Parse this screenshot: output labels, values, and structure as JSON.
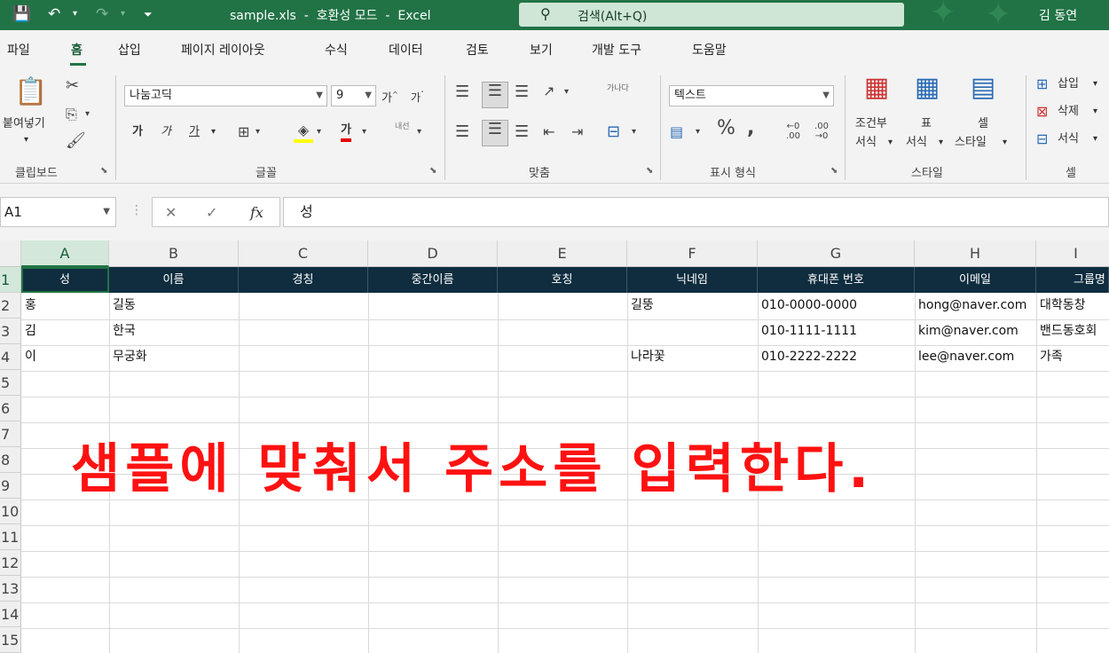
{
  "titlebar": {
    "title": "sample.xls  -  호환성 모드  -  Excel",
    "search_placeholder": "검색(Alt+Q)",
    "user": "김 동연"
  },
  "menu": [
    "파일",
    "홈",
    "삽입",
    "페이지 레이아웃",
    "수식",
    "데이터",
    "검토",
    "보기",
    "개발 도구",
    "도움말"
  ],
  "ribbon": {
    "clipboard": {
      "paste_label": "붙여넣기",
      "group": "클립보드"
    },
    "font": {
      "font_name": "나눔고딕",
      "font_size": "9",
      "group": "글꼴",
      "bold": "가",
      "italic": "가",
      "underline": "가",
      "font_color_glyph": "가",
      "phonetic": "내선"
    },
    "alignment": {
      "group": "맞춤",
      "wrap": "가나다"
    },
    "number": {
      "format": "텍스트",
      "group": "표시 형식"
    },
    "styles": {
      "group": "스타일",
      "conditional": "조건부\n서식",
      "cond1": "조건부",
      "cond2": "서식",
      "table1": "표",
      "table2": "서식",
      "cell1": "셀",
      "cell2": "스타일"
    },
    "cells": {
      "group": "셀",
      "insert": "삽입",
      "delete": "삭제",
      "format": "서식"
    }
  },
  "formula_bar": {
    "name_box": "A1",
    "content": "성"
  },
  "sheet": {
    "columns": [
      "A",
      "B",
      "C",
      "D",
      "E",
      "F",
      "G",
      "H",
      "I"
    ],
    "rows": [
      "1",
      "2",
      "3",
      "4",
      "5",
      "6",
      "7",
      "8",
      "9",
      "10",
      "11",
      "12",
      "13",
      "14",
      "15"
    ],
    "headers": [
      "성",
      "이름",
      "경칭",
      "중간이름",
      "호칭",
      "닉네임",
      "휴대폰 번호",
      "이메일",
      "그룹명"
    ],
    "data": [
      [
        "홍",
        "길동",
        "",
        "",
        "",
        "길뚱",
        "010-0000-0000",
        "hong@naver.com",
        "대학동창"
      ],
      [
        "김",
        "한국",
        "",
        "",
        "",
        "",
        "010-1111-1111",
        "kim@naver.com",
        "밴드동호회"
      ],
      [
        "이",
        "무궁화",
        "",
        "",
        "",
        "나라꽃",
        "010-2222-2222",
        "lee@naver.com",
        "가족"
      ]
    ]
  },
  "overlay_text": "샘플에 맞춰서 주소를 입력한다.",
  "colors": {
    "excel_green": "#217346",
    "header_fill": "#0f2d3f",
    "overlay_red": "#ff1111"
  }
}
